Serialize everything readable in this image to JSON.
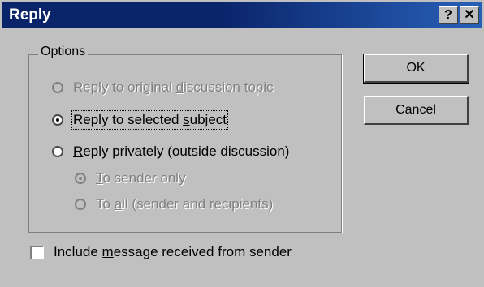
{
  "window": {
    "title": "Reply",
    "help_label": "?",
    "close_label": "✕"
  },
  "options": {
    "legend": "Options",
    "items": [
      {
        "pre": "Reply to original ",
        "key": "d",
        "post": "iscussion topic",
        "state": "disabled"
      },
      {
        "pre": "Reply to selected ",
        "key": "s",
        "post": "ubject",
        "state": "selected"
      },
      {
        "pre": "",
        "key": "R",
        "post": "eply privately (outside discussion)",
        "state": "normal"
      },
      {
        "pre": "",
        "key": "T",
        "post": "o sender only",
        "state": "disabled-selected"
      },
      {
        "pre": "To ",
        "key": "a",
        "post": "ll (sender and recipients)",
        "state": "disabled"
      }
    ]
  },
  "buttons": {
    "ok": "OK",
    "cancel": "Cancel"
  },
  "include": {
    "pre": "Include ",
    "key": "m",
    "post": "essage received from sender",
    "checked": false
  }
}
